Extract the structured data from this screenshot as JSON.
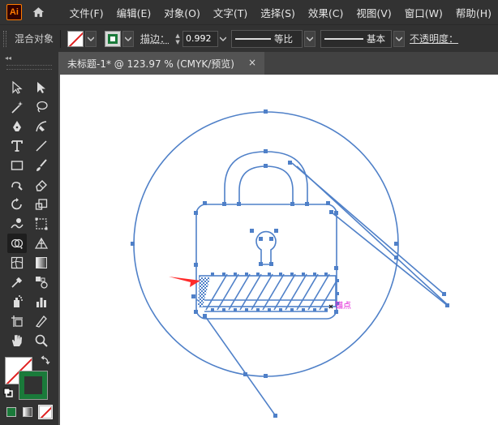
{
  "app": {
    "logo": "Ai",
    "menu": [
      "文件(F)",
      "编辑(E)",
      "对象(O)",
      "文字(T)",
      "选择(S)",
      "效果(C)",
      "视图(V)",
      "窗口(W)",
      "帮助(H)"
    ]
  },
  "control_bar": {
    "object_type": "混合对象",
    "stroke_label": "描边：",
    "stroke_weight": "0.992",
    "profile1_label": "等比",
    "profile2_label": "基本",
    "opacity_label": "不透明度："
  },
  "document": {
    "tab_title": "未标题-1* @ 123.97 % (CMYK/预览)",
    "close_glyph": "×"
  },
  "canvas": {
    "anchor_hint": "锚点",
    "accent_color": "#4f80c8",
    "hint_color": "#e01fd6",
    "arrow_color": "#ff2a2a"
  },
  "toolbar": {
    "collapse_glyph": "◂◂",
    "fill_color": "#ffffff",
    "stroke_color": "#1a7a3a",
    "tools": [
      "selection-icon",
      "direct-selection-icon",
      "magic-wand-icon",
      "lasso-icon",
      "pen-icon",
      "curvature-icon",
      "type-icon",
      "line-icon",
      "rectangle-icon",
      "paintbrush-icon",
      "shaper-icon",
      "eraser-icon",
      "rotate-icon",
      "scale-icon",
      "warp-icon",
      "free-transform-icon",
      "shape-builder-icon",
      "perspective-grid-icon",
      "mesh-icon",
      "gradient-icon",
      "eyedropper-icon",
      "blend-icon",
      "symbol-sprayer-icon",
      "column-graph-icon",
      "artboard-icon",
      "slice-icon",
      "hand-icon",
      "zoom-icon"
    ]
  }
}
